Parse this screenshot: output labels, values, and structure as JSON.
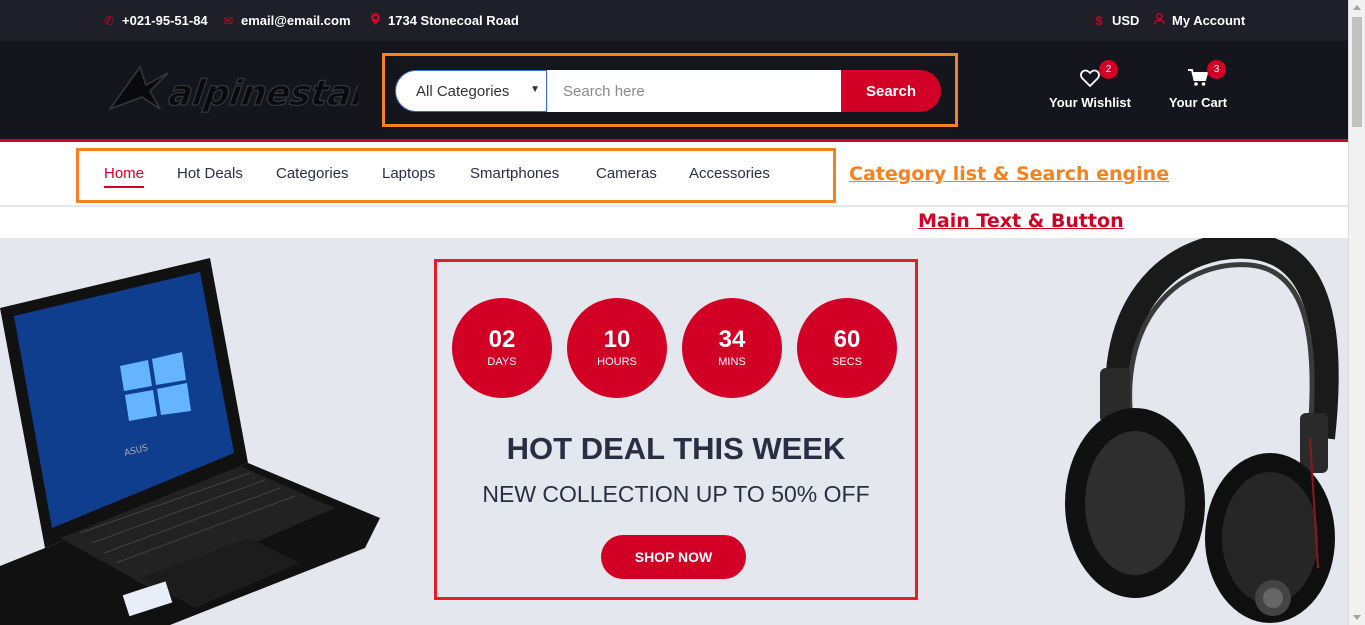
{
  "top_bar": {
    "phone": "+021-95-51-84",
    "email": "email@email.com",
    "address": "1734 Stonecoal Road",
    "currency": "USD",
    "account": "My Account",
    "icons": [
      "phone-icon",
      "envelope-icon",
      "map-marker-icon",
      "dollar-icon",
      "user-icon"
    ]
  },
  "header": {
    "logo_text": "alpinestars",
    "search": {
      "category_selected": "All Categories",
      "placeholder": "Search here",
      "value": "",
      "button_label": "Search"
    },
    "wishlist": {
      "label": "Your Wishlist",
      "count": "2"
    },
    "cart": {
      "label": "Your Cart",
      "count": "3"
    }
  },
  "nav": {
    "items": [
      {
        "label": "Home",
        "active": true
      },
      {
        "label": "Hot Deals"
      },
      {
        "label": "Categories"
      },
      {
        "label": "Laptops"
      },
      {
        "label": "Smartphones"
      },
      {
        "label": "Cameras"
      },
      {
        "label": "Accessories"
      }
    ]
  },
  "annotations": {
    "category_search": "Category list & Search engine",
    "main_text": "Main Text & Button"
  },
  "hero": {
    "countdown": [
      {
        "value": "02",
        "unit": "DAYS"
      },
      {
        "value": "10",
        "unit": "HOURS"
      },
      {
        "value": "34",
        "unit": "MINS"
      },
      {
        "value": "60",
        "unit": "SECS"
      }
    ],
    "title": "HOT DEAL THIS WEEK",
    "subtitle": "NEW COLLECTION UP TO 50% OFF",
    "button_label": "SHOP NOW",
    "laptop_brand": "ASUS"
  },
  "colors": {
    "accent": "#d10024",
    "dark": "#15161d",
    "topbar": "#1e1f29",
    "hero_bg": "#e4e7ed",
    "annotation_orange": "#f58220",
    "annotation_red": "#e41e26"
  }
}
